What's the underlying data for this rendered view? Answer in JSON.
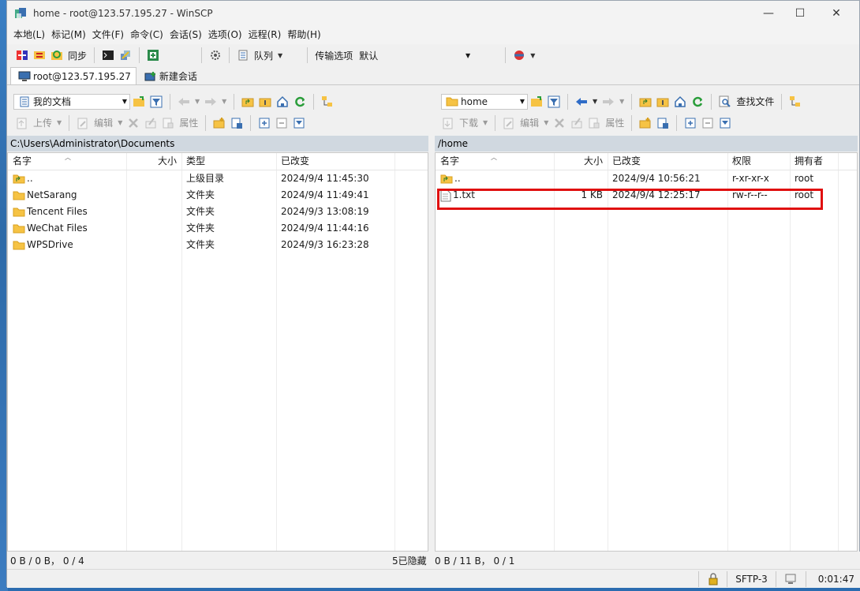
{
  "window": {
    "title": "home - root@123.57.195.27 - WinSCP",
    "minimize": "—",
    "maximize": "☐",
    "close": "✕"
  },
  "menu": [
    "本地(L)",
    "标记(M)",
    "文件(F)",
    "命令(C)",
    "会话(S)",
    "选项(O)",
    "远程(R)",
    "帮助(H)"
  ],
  "toolbar": {
    "sync_label": "同步",
    "queue_label": "队列",
    "transfer_label": "传输选项",
    "transfer_value": "默认"
  },
  "tabs": [
    {
      "label": "root@123.57.195.27"
    },
    {
      "label": "新建会话"
    }
  ],
  "left": {
    "location": "我的文档",
    "upload_label": "上传",
    "edit_label": "编辑",
    "props_label": "属性",
    "path": "C:\\Users\\Administrator\\Documents",
    "headers": {
      "name": "名字",
      "size": "大小",
      "type": "类型",
      "modified": "已改变"
    },
    "files": [
      {
        "name": "..",
        "size": "",
        "type": "上级目录",
        "modified": "2024/9/4   11:45:30",
        "icon": "parent-folder-icon"
      },
      {
        "name": "NetSarang",
        "size": "",
        "type": "文件夹",
        "modified": "2024/9/4   11:49:41",
        "icon": "folder-icon"
      },
      {
        "name": "Tencent Files",
        "size": "",
        "type": "文件夹",
        "modified": "2024/9/3   13:08:19",
        "icon": "folder-icon"
      },
      {
        "name": "WeChat Files",
        "size": "",
        "type": "文件夹",
        "modified": "2024/9/4   11:44:16",
        "icon": "folder-icon"
      },
      {
        "name": "WPSDrive",
        "size": "",
        "type": "文件夹",
        "modified": "2024/9/3   16:23:28",
        "icon": "folder-icon"
      }
    ],
    "status_left": "0 B / 0 B，  0 / 4",
    "status_hidden": "5已隐藏"
  },
  "right": {
    "location": "home",
    "find_label": "查找文件",
    "download_label": "下载",
    "edit_label": "编辑",
    "props_label": "属性",
    "path": "/home",
    "headers": {
      "name": "名字",
      "size": "大小",
      "modified": "已改变",
      "perms": "权限",
      "owner": "拥有者"
    },
    "files": [
      {
        "name": "..",
        "size": "",
        "modified": "2024/9/4 10:56:21",
        "perms": "r-xr-xr-x",
        "owner": "root",
        "icon": "parent-folder-icon"
      },
      {
        "name": "1.txt",
        "size": "1 KB",
        "modified": "2024/9/4 12:25:17",
        "perms": "rw-r--r--",
        "owner": "root",
        "icon": "text-file-icon"
      }
    ],
    "status": "0 B / 11 B，  0 / 1"
  },
  "bottom": {
    "protocol": "SFTP-3",
    "time": "0:01:47"
  },
  "colors": {
    "highlight": "#e01010",
    "pathbar": "#d0d8e0",
    "folder": "#f6c344"
  }
}
